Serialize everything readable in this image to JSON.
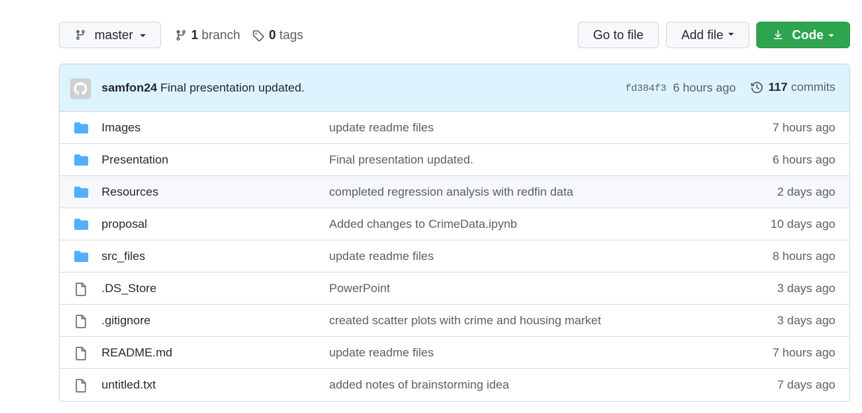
{
  "toolbar": {
    "branch_label": "master",
    "branches_count": "1",
    "branches_word": "branch",
    "tags_count": "0",
    "tags_word": "tags",
    "goto_label": "Go to file",
    "addfile_label": "Add file",
    "code_label": "Code"
  },
  "commit": {
    "author": "samfon24",
    "message": "Final presentation updated.",
    "sha": "fd384f3",
    "time": "6 hours ago",
    "count": "117",
    "count_word": "commits"
  },
  "colors": {
    "folder": "#54aeff",
    "primary": "#2da44e",
    "commit_bar": "#ddf4ff"
  },
  "files": [
    {
      "type": "folder",
      "name": "Images",
      "message": "update readme files",
      "age": "7 hours ago"
    },
    {
      "type": "folder",
      "name": "Presentation",
      "message": "Final presentation updated.",
      "age": "6 hours ago"
    },
    {
      "type": "folder",
      "name": "Resources",
      "message": "completed regression analysis with redfin data",
      "age": "2 days ago"
    },
    {
      "type": "folder",
      "name": "proposal",
      "message": "Added changes to CrimeData.ipynb",
      "age": "10 days ago"
    },
    {
      "type": "folder",
      "name": "src_files",
      "message": "update readme files",
      "age": "8 hours ago"
    },
    {
      "type": "file",
      "name": ".DS_Store",
      "message": "PowerPoint",
      "age": "3 days ago"
    },
    {
      "type": "file",
      "name": ".gitignore",
      "message": "created scatter plots with crime and housing market",
      "age": "3 days ago"
    },
    {
      "type": "file",
      "name": "README.md",
      "message": "update readme files",
      "age": "7 hours ago"
    },
    {
      "type": "file",
      "name": "untitled.txt",
      "message": "added notes of brainstorming idea",
      "age": "7 days ago"
    }
  ]
}
